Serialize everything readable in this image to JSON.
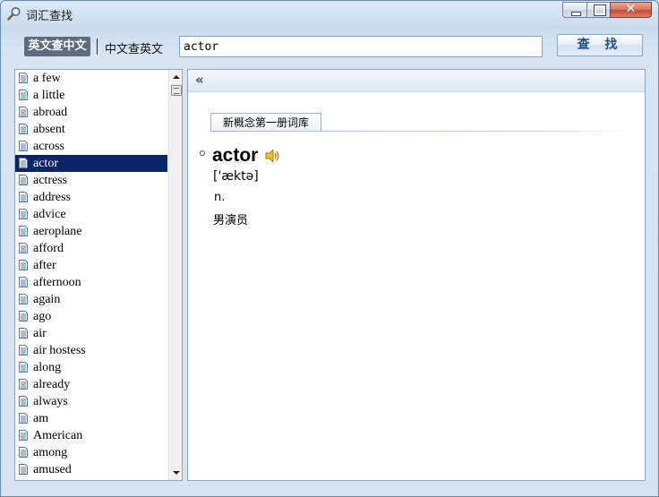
{
  "window": {
    "title": "词汇查找",
    "icons": {
      "app": "magnifier-icon",
      "min": "minimize-icon",
      "max": "maximize-icon",
      "close": "close-icon"
    }
  },
  "toolbar": {
    "mode_active": "英文查中文",
    "mode_other": "中文查英文",
    "search_value": "actor",
    "search_button": "查 找"
  },
  "word_list": {
    "items": [
      "a few",
      "a little",
      "abroad",
      "absent",
      "across",
      "actor",
      "actress",
      "address",
      "advice",
      "aeroplane",
      "afford",
      "after",
      "afternoon",
      "again",
      "ago",
      "air",
      "air hostess",
      "along",
      "already",
      "always",
      "am",
      "American",
      "among",
      "amused"
    ],
    "selected": "actor",
    "item_icon": "document-icon"
  },
  "definition": {
    "collapse_label": "«",
    "book_tab": "新概念第一册词库",
    "headword": "actor",
    "phonetic": "['æktə]",
    "part_of_speech": "n.",
    "meaning": "男演员",
    "speaker_icon": "speaker-icon"
  },
  "colors": {
    "selection": "#0a246a",
    "accent": "#1d4e86",
    "mode_active_bg": "#5e6c7d"
  }
}
